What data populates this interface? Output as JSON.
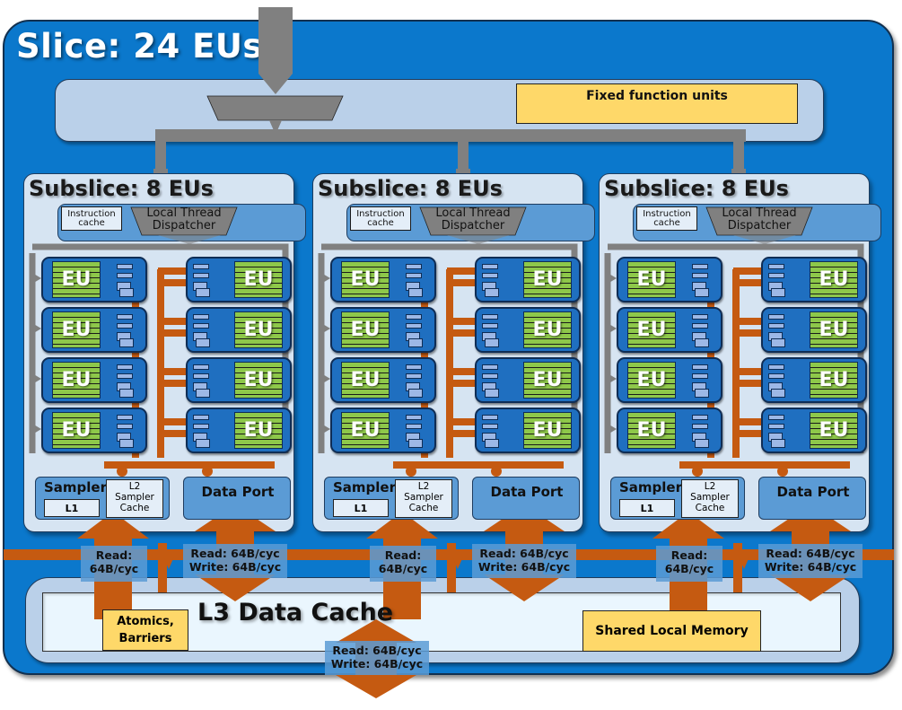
{
  "slice": {
    "title": "Slice: 24 EUs",
    "fixed_function_label": "Fixed function units"
  },
  "subslices": [
    {
      "title": "Subslice: 8 EUs",
      "instruction_cache": [
        "Instruction",
        "cache"
      ],
      "dispatcher": [
        "Local Thread",
        "Dispatcher"
      ],
      "eu_label": "EU",
      "eu_count": 8,
      "sampler": {
        "label": "Sampler",
        "l1": "L1",
        "l2": [
          "L2",
          "Sampler",
          "Cache"
        ]
      },
      "data_port": "Data Port",
      "sampler_bandwidth": [
        "Read:",
        "64B/cyc"
      ],
      "dataport_bandwidth": [
        "Read: 64B/cyc",
        "Write: 64B/cyc"
      ]
    },
    {
      "title": "Subslice: 8 EUs",
      "instruction_cache": [
        "Instruction",
        "cache"
      ],
      "dispatcher": [
        "Local Thread",
        "Dispatcher"
      ],
      "eu_label": "EU",
      "eu_count": 8,
      "sampler": {
        "label": "Sampler",
        "l1": "L1",
        "l2": [
          "L2",
          "Sampler",
          "Cache"
        ]
      },
      "data_port": "Data Port",
      "sampler_bandwidth": [
        "Read:",
        "64B/cyc"
      ],
      "dataport_bandwidth": [
        "Read: 64B/cyc",
        "Write: 64B/cyc"
      ]
    },
    {
      "title": "Subslice: 8 EUs",
      "instruction_cache": [
        "Instruction",
        "cache"
      ],
      "dispatcher": [
        "Local Thread",
        "Dispatcher"
      ],
      "eu_label": "EU",
      "eu_count": 8,
      "sampler": {
        "label": "Sampler",
        "l1": "L1",
        "l2": [
          "L2",
          "Sampler",
          "Cache"
        ]
      },
      "data_port": "Data Port",
      "sampler_bandwidth": [
        "Read:",
        "64B/cyc"
      ],
      "dataport_bandwidth": [
        "Read: 64B/cyc",
        "Write: 64B/cyc"
      ]
    }
  ],
  "l3": {
    "title": "L3 Data Cache",
    "atomics": [
      "Atomics,",
      "Barriers"
    ],
    "shared_local_memory": "Shared Local Memory",
    "external_bandwidth": [
      "Read: 64B/cyc",
      "Write: 64B/cyc"
    ]
  },
  "colors": {
    "slice_blue": "#0b78cc",
    "panel_light": "#bad0e9",
    "subslice_bg": "#d6e4f2",
    "mid_blue": "#5b9bd5",
    "eu_green": "#8ec84a",
    "bus_orange": "#c55a11",
    "arrow_gray": "#808080",
    "highlight_yellow": "#fed869"
  }
}
